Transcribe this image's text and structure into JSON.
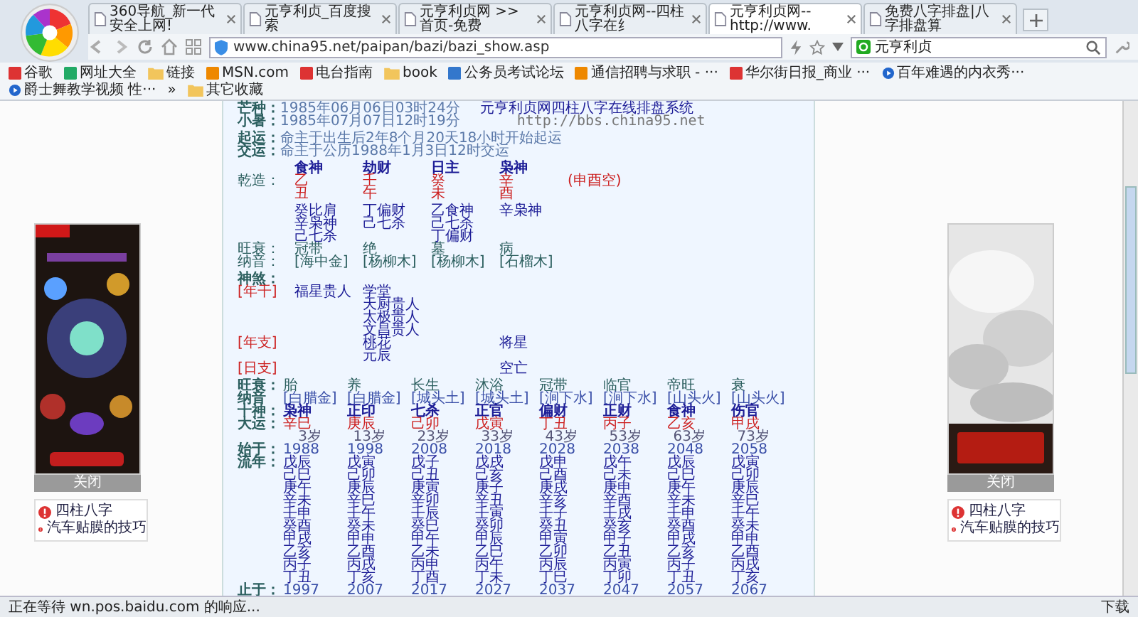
{
  "browser": {
    "tabs": [
      {
        "title": "360导航_新一代安全上网!",
        "selected": false
      },
      {
        "title": "元亨利贞_百度搜索",
        "selected": false
      },
      {
        "title": "元亨利贞网 >> 首页-免费",
        "selected": false
      },
      {
        "title": "元亨利贞网--四柱八字在纟",
        "selected": false
      },
      {
        "title": "元亨利贞网--http://www.",
        "selected": true
      },
      {
        "title": "免费八字排盘|八字排盘算",
        "selected": false
      }
    ],
    "address": "www.china95.net/paipan/bazi/bazi_show.asp",
    "search_value": "元亨利贞"
  },
  "bookmarks": [
    {
      "label": "谷歌",
      "kind": "site"
    },
    {
      "label": "网址大全",
      "kind": "site"
    },
    {
      "label": "链接",
      "kind": "folder"
    },
    {
      "label": "MSN.com",
      "kind": "site"
    },
    {
      "label": "电台指南",
      "kind": "site"
    },
    {
      "label": "book",
      "kind": "folder"
    },
    {
      "label": "公务员考试论坛",
      "kind": "site"
    },
    {
      "label": "通信招聘与求职 - ···",
      "kind": "site"
    },
    {
      "label": "华尔街日报_商业 ···",
      "kind": "site"
    },
    {
      "label": "百年难遇的内衣秀···",
      "kind": "video"
    },
    {
      "label": "爵士舞教学视频 性···",
      "kind": "video"
    },
    {
      "label": "»",
      "kind": "text"
    },
    {
      "label": "其它收藏",
      "kind": "folder"
    }
  ],
  "left_ad": {
    "close": "关闭",
    "links": [
      "四柱八字",
      "汽车贴膜的技巧"
    ]
  },
  "right_ad": {
    "close": "关闭",
    "links": [
      "四柱八字",
      "汽车贴膜的技巧"
    ]
  },
  "solar_terms": [
    {
      "label": "芒种：",
      "value": "1985年06月06日03时24分"
    },
    {
      "label": "小暑：",
      "value": "1985年07月07日12时19分"
    }
  ],
  "site_title": "元亨利贞网四柱八字在线排盘系统",
  "site_url": "http://bbs.china95.net",
  "luck_start": [
    {
      "label": "起运：",
      "value": "命主于出生后2年8个月20天18小时开始起运"
    },
    {
      "label": "交运：",
      "value": "命主于公历1988年1月3日12时交运"
    }
  ],
  "chart": {
    "label": "乾造：",
    "void": "(申酉空)",
    "wangshuai_label": "旺衰：",
    "nayin_label": "纳音：",
    "pillars": [
      {
        "god": "食神",
        "stem": "乙",
        "branch": "丑",
        "hidden": [
          "癸比肩",
          "辛枭神",
          "己七杀"
        ],
        "wangshuai": "冠带",
        "nayin": "[海中金]"
      },
      {
        "god": "劫财",
        "stem": "壬",
        "branch": "午",
        "hidden": [
          "丁偏财",
          "己七杀"
        ],
        "wangshuai": "绝",
        "nayin": "[杨柳木]"
      },
      {
        "god": "日主",
        "stem": "癸",
        "branch": "未",
        "hidden": [
          "乙食神",
          "己七杀",
          "丁偏财"
        ],
        "wangshuai": "墓",
        "nayin": "[杨柳木]"
      },
      {
        "god": "枭神",
        "stem": "辛",
        "branch": "酉",
        "hidden": [
          "辛枭神"
        ],
        "wangshuai": "病",
        "nayin": "[石榴木]"
      }
    ]
  },
  "shensha": {
    "label": "神煞：",
    "rows": [
      {
        "pillar": "[年干]",
        "cells": [
          [
            "福星贵人"
          ],
          [
            "学堂",
            "天厨贵人",
            "太极贵人",
            "文昌贵人"
          ],
          [],
          []
        ]
      },
      {
        "pillar": "[年支]",
        "cells": [
          [],
          [
            "桃花",
            "元辰"
          ],
          [],
          [
            "将星"
          ]
        ]
      },
      {
        "pillar": "[日支]",
        "cells": [
          [],
          [],
          [],
          [
            "空亡"
          ]
        ]
      }
    ]
  },
  "dayun": {
    "rows": [
      {
        "kind": "wangshuai",
        "label": "旺衰：",
        "cells": [
          "胎",
          "养",
          "长生",
          "沐浴",
          "冠带",
          "临官",
          "帝旺",
          "衰"
        ]
      },
      {
        "kind": "nayin",
        "label": "纳音",
        "cells": [
          "[白腊金]",
          "[白腊金]",
          "[城头土]",
          "[城头土]",
          "[涧下水]",
          "[涧下水]",
          "[山头火]",
          "[山头火]"
        ]
      },
      {
        "kind": "god",
        "label": "十神：",
        "cells": [
          "枭神",
          "正印",
          "七杀",
          "正官",
          "偏财",
          "正财",
          "食神",
          "伤官"
        ]
      },
      {
        "kind": "luck",
        "label": "大运：",
        "cells": [
          "辛巳",
          "庚辰",
          "己卯",
          "戊寅",
          "丁丑",
          "丙子",
          "乙亥",
          "甲戌"
        ]
      },
      {
        "kind": "age",
        "cells": [
          "3岁",
          "13岁",
          "23岁",
          "33岁",
          "43岁",
          "53岁",
          "63岁",
          "73岁"
        ]
      },
      {
        "kind": "year",
        "label": "始于：",
        "cells": [
          "1988",
          "1998",
          "2008",
          "2018",
          "2028",
          "2038",
          "2048",
          "2058"
        ]
      }
    ],
    "liunian_label": "流年：",
    "liunian": [
      [
        "戊辰",
        "己巳",
        "庚午",
        "辛未",
        "壬申",
        "癸酉",
        "甲戌",
        "乙亥",
        "丙子",
        "丁丑"
      ],
      [
        "戊寅",
        "己卯",
        "庚辰",
        "辛巳",
        "壬午",
        "癸未",
        "甲申",
        "乙酉",
        "丙戌",
        "丁亥"
      ],
      [
        "戊子",
        "己丑",
        "庚寅",
        "辛卯",
        "壬辰",
        "癸巳",
        "甲午",
        "乙未",
        "丙申",
        "丁酉"
      ],
      [
        "戊戌",
        "己亥",
        "庚子",
        "辛丑",
        "壬寅",
        "癸卯",
        "甲辰",
        "乙巳",
        "丙午",
        "丁未"
      ],
      [
        "戊申",
        "己酉",
        "庚戌",
        "辛亥",
        "壬子",
        "癸丑",
        "甲寅",
        "乙卯",
        "丙辰",
        "丁巳"
      ],
      [
        "戊午",
        "己未",
        "庚申",
        "辛酉",
        "壬戌",
        "癸亥",
        "甲子",
        "乙丑",
        "丙寅",
        "丁卯"
      ],
      [
        "戊辰",
        "己巳",
        "庚午",
        "辛未",
        "壬申",
        "癸酉",
        "甲戌",
        "乙亥",
        "丙子",
        "丁丑"
      ],
      [
        "戊寅",
        "己卯",
        "庚辰",
        "辛巳",
        "壬午",
        "癸未",
        "甲申",
        "乙酉",
        "丙戌",
        "丁亥"
      ]
    ],
    "end_label": "止于：",
    "end_years": [
      "1997",
      "2007",
      "2017",
      "2027",
      "2037",
      "2047",
      "2057",
      "2067"
    ]
  },
  "status_bar": {
    "text": "正在等待 wn.pos.baidu.com 的响应...",
    "download": "下载"
  }
}
